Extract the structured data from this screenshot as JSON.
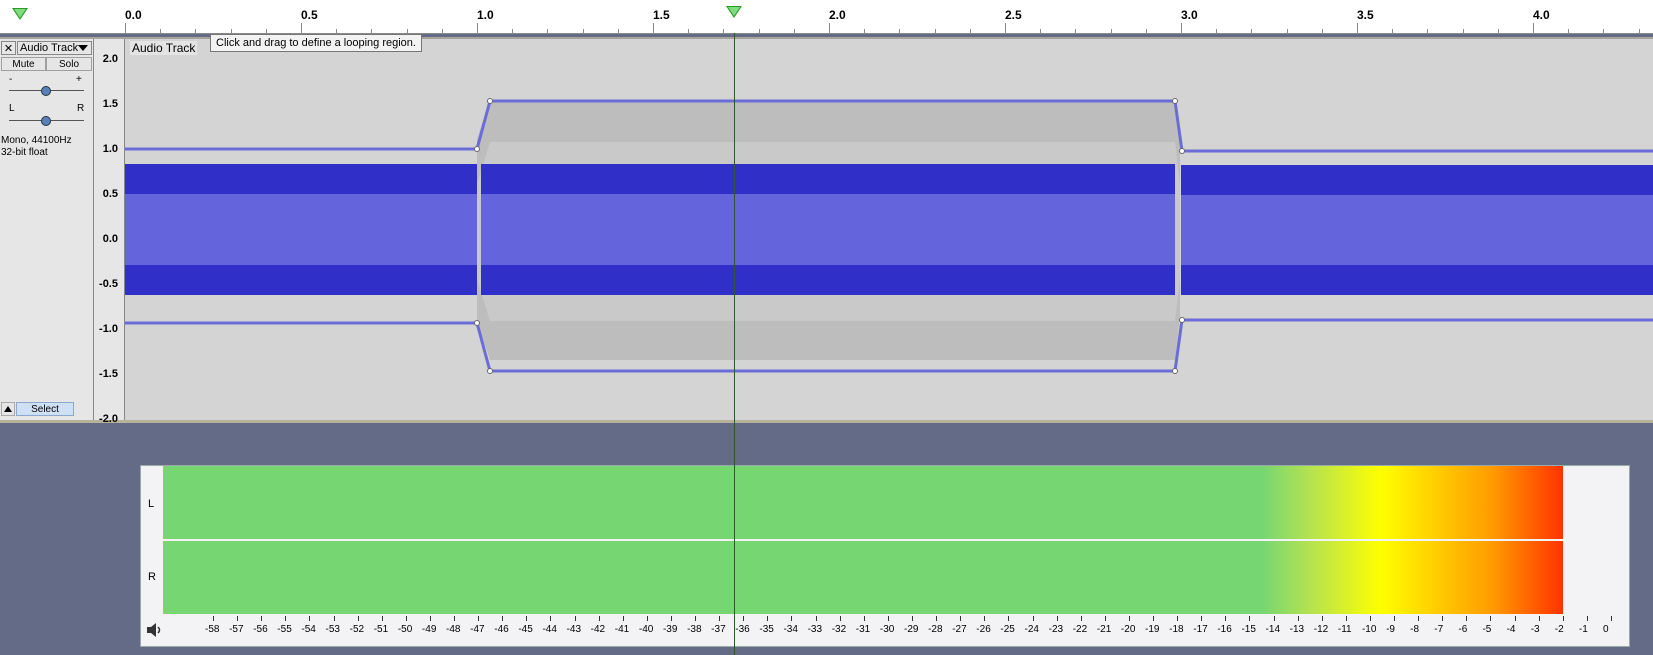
{
  "ruler": {
    "labels": [
      "0.0",
      "0.5",
      "1.0",
      "1.5",
      "2.0",
      "2.5",
      "3.0",
      "3.5",
      "4.0"
    ]
  },
  "tooltip": "Click and drag to define a looping region.",
  "track": {
    "close_label": "✕",
    "name": "Audio Track",
    "menu_label": "Audio Track",
    "mute_label": "Mute",
    "solo_label": "Solo",
    "gain_minus": "-",
    "gain_plus": "+",
    "pan_left": "L",
    "pan_right": "R",
    "format_line1": "Mono, 44100Hz",
    "format_line2": "32-bit float",
    "select_label": "Select",
    "collapse_icon": "triangle-up-icon"
  },
  "vscale": [
    "2.0",
    "1.5",
    "1.0",
    "0.5",
    "0.0",
    "-0.5",
    "-1.0",
    "-1.5",
    "-2.0"
  ],
  "meter": {
    "left_label": "L",
    "right_label": "R",
    "speaker_icon": "speaker-icon",
    "scale": [
      "-58",
      "-57",
      "-56",
      "-55",
      "-54",
      "-53",
      "-52",
      "-51",
      "-50",
      "-49",
      "-48",
      "-47",
      "-46",
      "-45",
      "-44",
      "-43",
      "-42",
      "-41",
      "-40",
      "-39",
      "-38",
      "-37",
      "-36",
      "-35",
      "-34",
      "-33",
      "-32",
      "-31",
      "-30",
      "-29",
      "-28",
      "-27",
      "-26",
      "-25",
      "-24",
      "-23",
      "-22",
      "-21",
      "-20",
      "-19",
      "-18",
      "-17",
      "-16",
      "-15",
      "-14",
      "-13",
      "-12",
      "-11",
      "-10",
      "-9",
      "-8",
      "-7",
      "-6",
      "-5",
      "-4",
      "-3",
      "-2",
      "-1",
      "0"
    ]
  },
  "colors": {
    "wave_dark": "#3030c8",
    "wave_light": "#6464dc",
    "envelope": "#6c6cd8",
    "cursor": "#2d5a2d"
  }
}
